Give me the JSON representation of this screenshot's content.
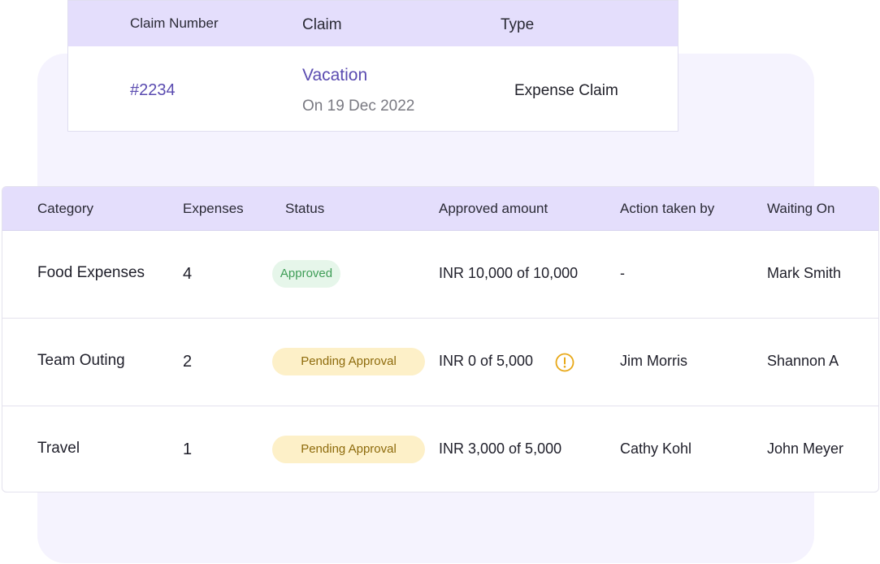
{
  "claim": {
    "headers": {
      "number": "Claim Number",
      "claim": "Claim",
      "type": "Type"
    },
    "number": "#2234",
    "name": "Vacation",
    "date": "On 19 Dec 2022",
    "type": "Expense Claim"
  },
  "expenses": {
    "headers": {
      "category": "Category",
      "expenses": "Expenses",
      "status": "Status",
      "approved_amount": "Approved amount",
      "action_taken_by": "Action taken by",
      "waiting_on": "Waiting On"
    },
    "rows": [
      {
        "category": "Food Expenses",
        "expenses": "4",
        "status": "Approved",
        "approved_amount": "INR 10,000 of 10,000",
        "action_taken_by": "-",
        "waiting_on": "Mark Smith"
      },
      {
        "category": "Team Outing",
        "expenses": "2",
        "status": "Pending Approval",
        "approved_amount": "INR 0 of 5,000",
        "warning_icon": "exclamation-circle-icon",
        "action_taken_by": "Jim Morris",
        "waiting_on": "Shannon A"
      },
      {
        "category": "Travel",
        "expenses": "1",
        "status": "Pending Approval",
        "approved_amount": "INR 3,000 of 5,000",
        "action_taken_by": "Cathy Kohl",
        "waiting_on": "John Meyer"
      }
    ]
  },
  "colors": {
    "header_bg": "#e4defc",
    "accent": "#5a4bb0",
    "approved_bg": "#e6f6ea",
    "approved_text": "#3f9d57",
    "pending_bg": "#fdf0c8",
    "pending_text": "#8e6b0c",
    "warning": "#e8a817",
    "panel_bg": "#f5f3fe"
  }
}
